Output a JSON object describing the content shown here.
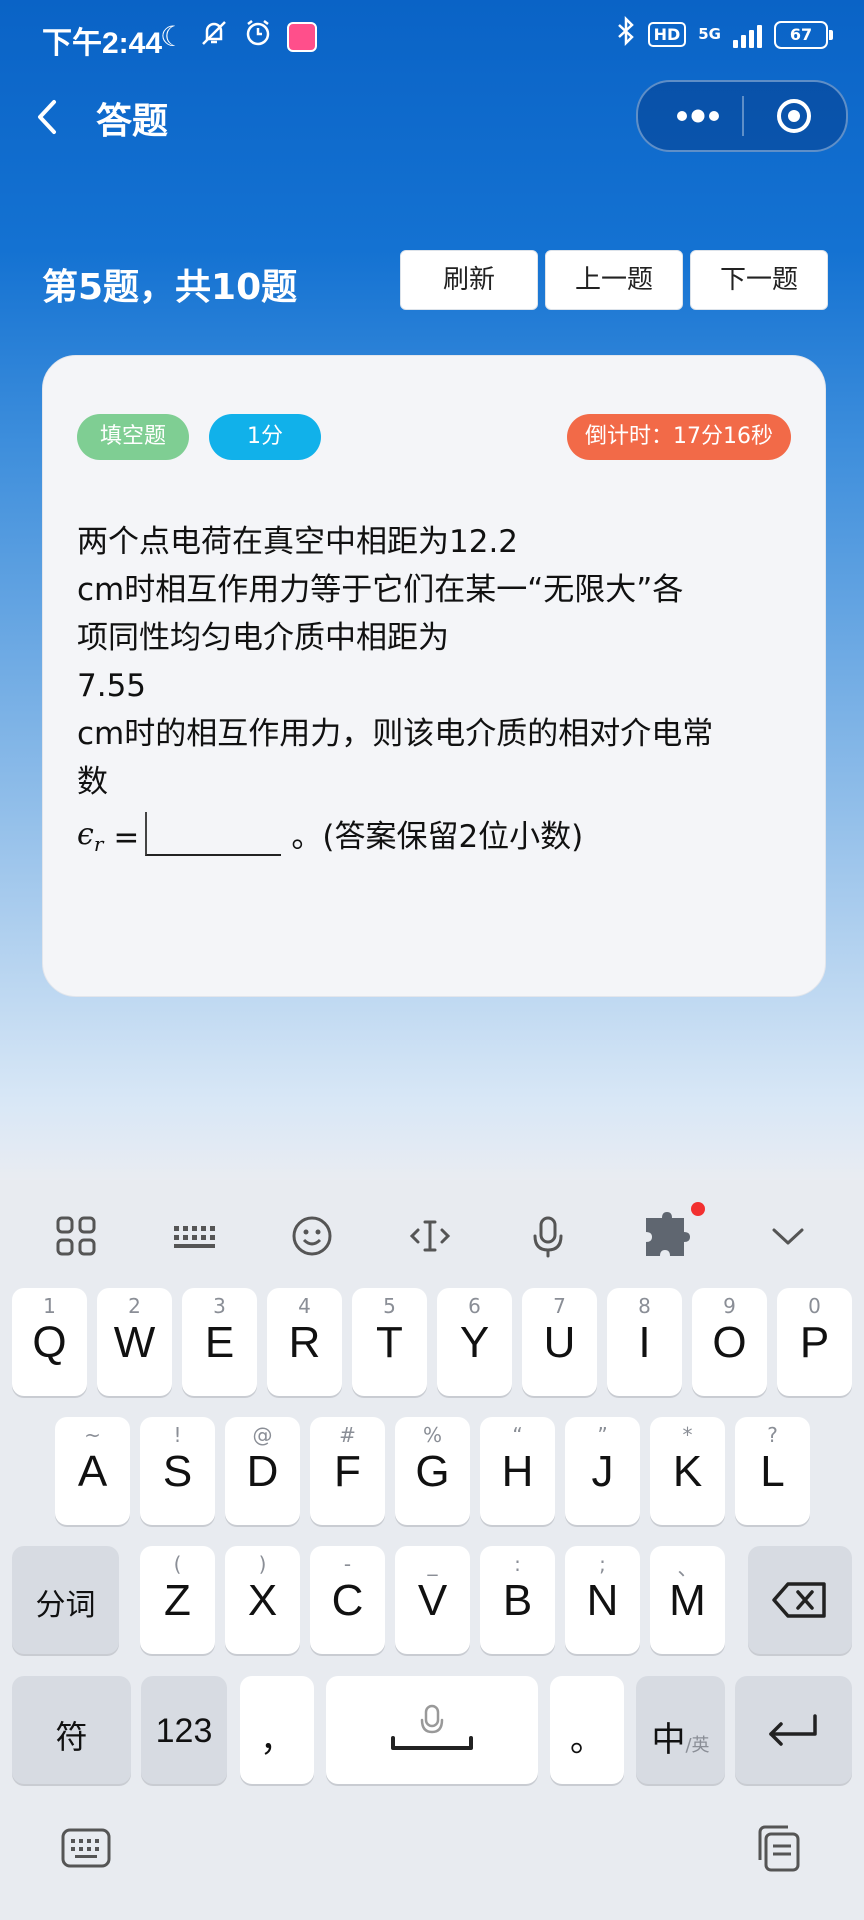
{
  "status_bar": {
    "time": "下午2:44",
    "hd": "HD",
    "network": "5G",
    "battery": "67"
  },
  "nav": {
    "title": "答题"
  },
  "header": {
    "question_count": "第5题，共10题",
    "refresh": "刷新",
    "prev": "上一题",
    "next": "下一题"
  },
  "card": {
    "type_tag": "填空题",
    "score_tag": "1分",
    "timer": "倒计时：17分16秒",
    "question_lines": [
      "两个点电荷在真空中相距为12.2",
      "cm时相互作用力等于它们在某一“无限大”各",
      "项同性均匀电介质中相距为",
      "7.55",
      "cm时的相互作用力，则该电介质的相对介电常",
      "数"
    ],
    "answer_prefix": "ϵ",
    "answer_sub": "r",
    "answer_eq": "=",
    "answer_suffix": "。(答案保留2位小数)"
  },
  "keyboard": {
    "row1": [
      {
        "num": "1",
        "letter": "Q"
      },
      {
        "num": "2",
        "letter": "W"
      },
      {
        "num": "3",
        "letter": "E"
      },
      {
        "num": "4",
        "letter": "R"
      },
      {
        "num": "5",
        "letter": "T"
      },
      {
        "num": "6",
        "letter": "Y"
      },
      {
        "num": "7",
        "letter": "U"
      },
      {
        "num": "8",
        "letter": "I"
      },
      {
        "num": "9",
        "letter": "O"
      },
      {
        "num": "0",
        "letter": "P"
      }
    ],
    "row2": [
      {
        "num": "~",
        "letter": "A"
      },
      {
        "num": "!",
        "letter": "S"
      },
      {
        "num": "@",
        "letter": "D"
      },
      {
        "num": "#",
        "letter": "F"
      },
      {
        "num": "%",
        "letter": "G"
      },
      {
        "num": "“",
        "letter": "H"
      },
      {
        "num": "”",
        "letter": "J"
      },
      {
        "num": "*",
        "letter": "K"
      },
      {
        "num": "?",
        "letter": "L"
      }
    ],
    "row3": [
      {
        "num": "(",
        "letter": "Z"
      },
      {
        "num": ")",
        "letter": "X"
      },
      {
        "num": "-",
        "letter": "C"
      },
      {
        "num": "_",
        "letter": "V"
      },
      {
        "num": ":",
        "letter": "B"
      },
      {
        "num": ";",
        "letter": "N"
      },
      {
        "num": "、",
        "letter": "M"
      }
    ],
    "fenci": "分词",
    "fu": "符",
    "num123": "123",
    "comma": "，",
    "period": "。",
    "lang_main": "中",
    "lang_sub": "/英"
  }
}
